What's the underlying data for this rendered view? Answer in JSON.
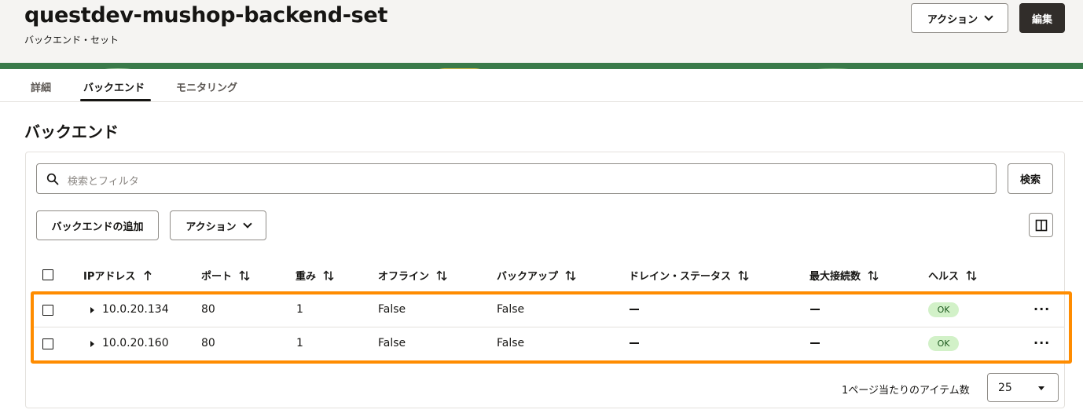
{
  "header": {
    "title": "questdev-mushop-backend-set",
    "subtitle": "バックエンド・セット",
    "actions_label": "アクション",
    "edit_label": "編集"
  },
  "tabs": [
    {
      "label": "詳細",
      "active": false
    },
    {
      "label": "バックエンド",
      "active": true
    },
    {
      "label": "モニタリング",
      "active": false
    }
  ],
  "section": {
    "title": "バックエンド"
  },
  "search": {
    "placeholder": "検索とフィルタ",
    "button_label": "検索"
  },
  "toolbar": {
    "add_label": "バックエンドの追加",
    "actions_label": "アクション"
  },
  "table": {
    "columns": [
      "IPアドレス",
      "ポート",
      "重み",
      "オフライン",
      "バックアップ",
      "ドレイン・ステータス",
      "最大接続数",
      "ヘルス"
    ],
    "rows": [
      {
        "ip": "10.0.20.134",
        "port": "80",
        "weight": "1",
        "offline": "False",
        "backup": "False",
        "health": "OK"
      },
      {
        "ip": "10.0.20.160",
        "port": "80",
        "weight": "1",
        "offline": "False",
        "backup": "False",
        "health": "OK"
      }
    ]
  },
  "pagination": {
    "label": "1ページ当たりのアイテム数",
    "value": "25"
  },
  "colors": {
    "highlight": "#ff8c00",
    "health_ok_bg": "#d2f1c8",
    "header_bg": "#f5f4f2",
    "primary_btn": "#312d2a"
  }
}
